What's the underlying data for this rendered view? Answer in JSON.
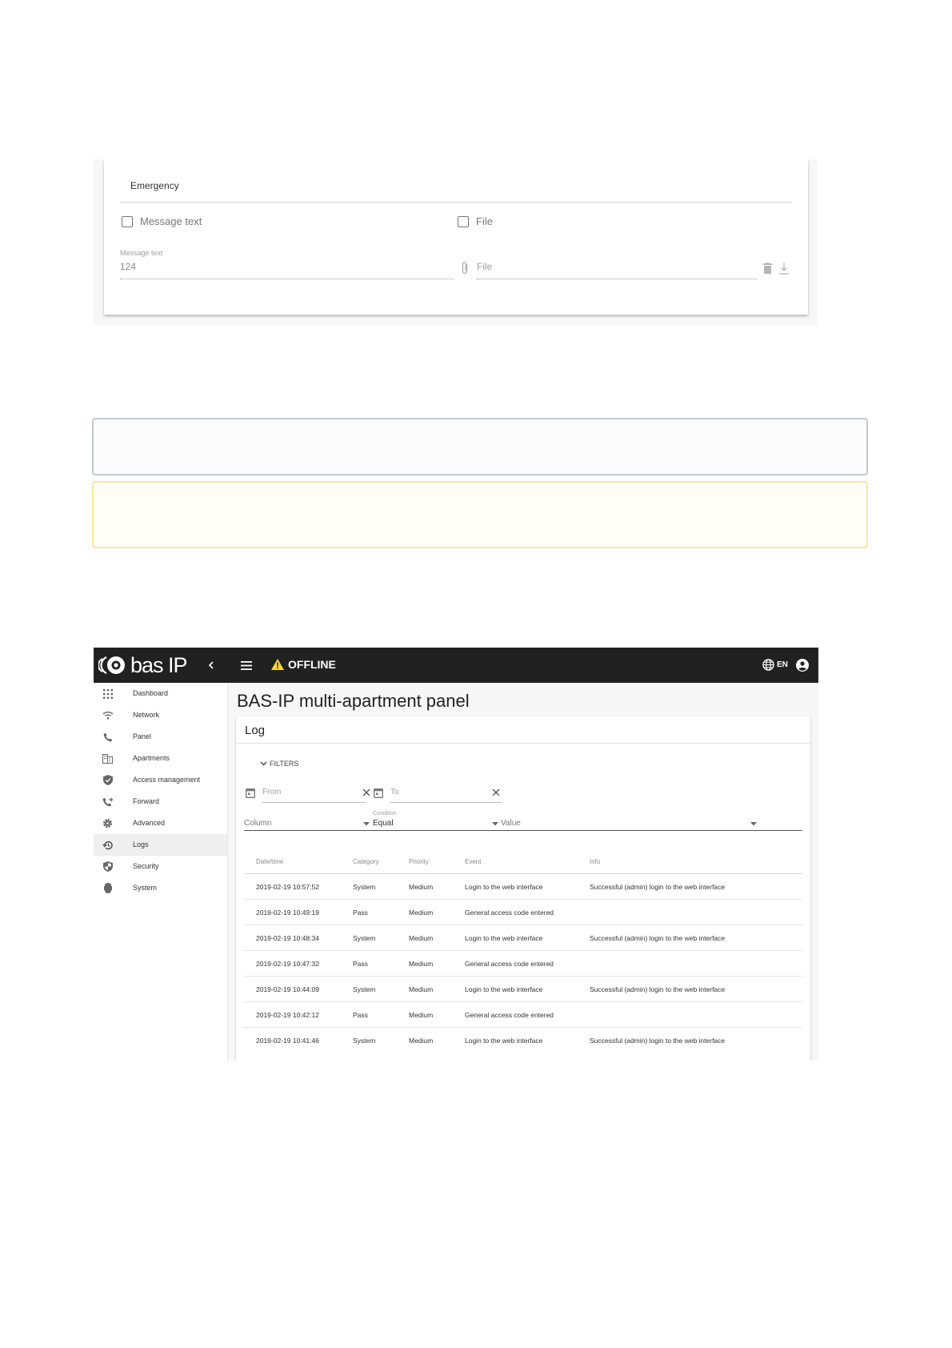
{
  "emergency_form": {
    "section_title": "Emergency",
    "message_checkbox_label": "Message text",
    "file_checkbox_label": "File",
    "message_field_label": "Message text",
    "message_field_value": "124",
    "file_field_placeholder": "File"
  },
  "app": {
    "logo_text": "bas IP",
    "status_text": "OFFLINE",
    "language": "EN"
  },
  "sidebar": {
    "items": [
      {
        "label": "Dashboard",
        "icon": "grid-icon"
      },
      {
        "label": "Network",
        "icon": "wifi-icon"
      },
      {
        "label": "Panel",
        "icon": "phone-icon"
      },
      {
        "label": "Apartments",
        "icon": "building-icon"
      },
      {
        "label": "Access management",
        "icon": "shield-check-icon"
      },
      {
        "label": "Forward",
        "icon": "phone-forward-icon"
      },
      {
        "label": "Advanced",
        "icon": "gear-icon"
      },
      {
        "label": "Logs",
        "icon": "history-icon",
        "active": true
      },
      {
        "label": "Security",
        "icon": "security-icon"
      },
      {
        "label": "System",
        "icon": "chip-icon"
      }
    ]
  },
  "page": {
    "title": "BAS-IP multi-apartment panel",
    "card_title": "Log",
    "filters_label": "FILTERS",
    "from_placeholder": "From",
    "to_placeholder": "To",
    "column_placeholder": "Column",
    "condition_label": "Condition",
    "condition_value": "Equal",
    "value_placeholder": "Value"
  },
  "table": {
    "columns": [
      "Date/time",
      "Category",
      "Priority",
      "Event",
      "Info"
    ],
    "rows": [
      [
        "2019-02-19 10:57:52",
        "System",
        "Medium",
        "Login to the web interface",
        "Successful (admin) login to the web interface"
      ],
      [
        "2019-02-19 10:49:19",
        "Pass",
        "Medium",
        "General access code entered",
        ""
      ],
      [
        "2019-02-19 10:48:34",
        "System",
        "Medium",
        "Login to the web interface",
        "Successful (admin) login to the web interface"
      ],
      [
        "2019-02-19 10:47:32",
        "Pass",
        "Medium",
        "General access code entered",
        ""
      ],
      [
        "2019-02-19 10:44:09",
        "System",
        "Medium",
        "Login to the web interface",
        "Successful (admin) login to the web interface"
      ],
      [
        "2019-02-19 10:42:12",
        "Pass",
        "Medium",
        "General access code entered",
        ""
      ],
      [
        "2019-02-19 10:41:46",
        "System",
        "Medium",
        "Login to the web interface",
        "Successful (admin) login to the web interface"
      ]
    ]
  },
  "colors": {
    "topbar": "#212121",
    "warning": "#fdd835",
    "note_border": "#c3cad2",
    "warn_border": "#fbe6a0"
  }
}
